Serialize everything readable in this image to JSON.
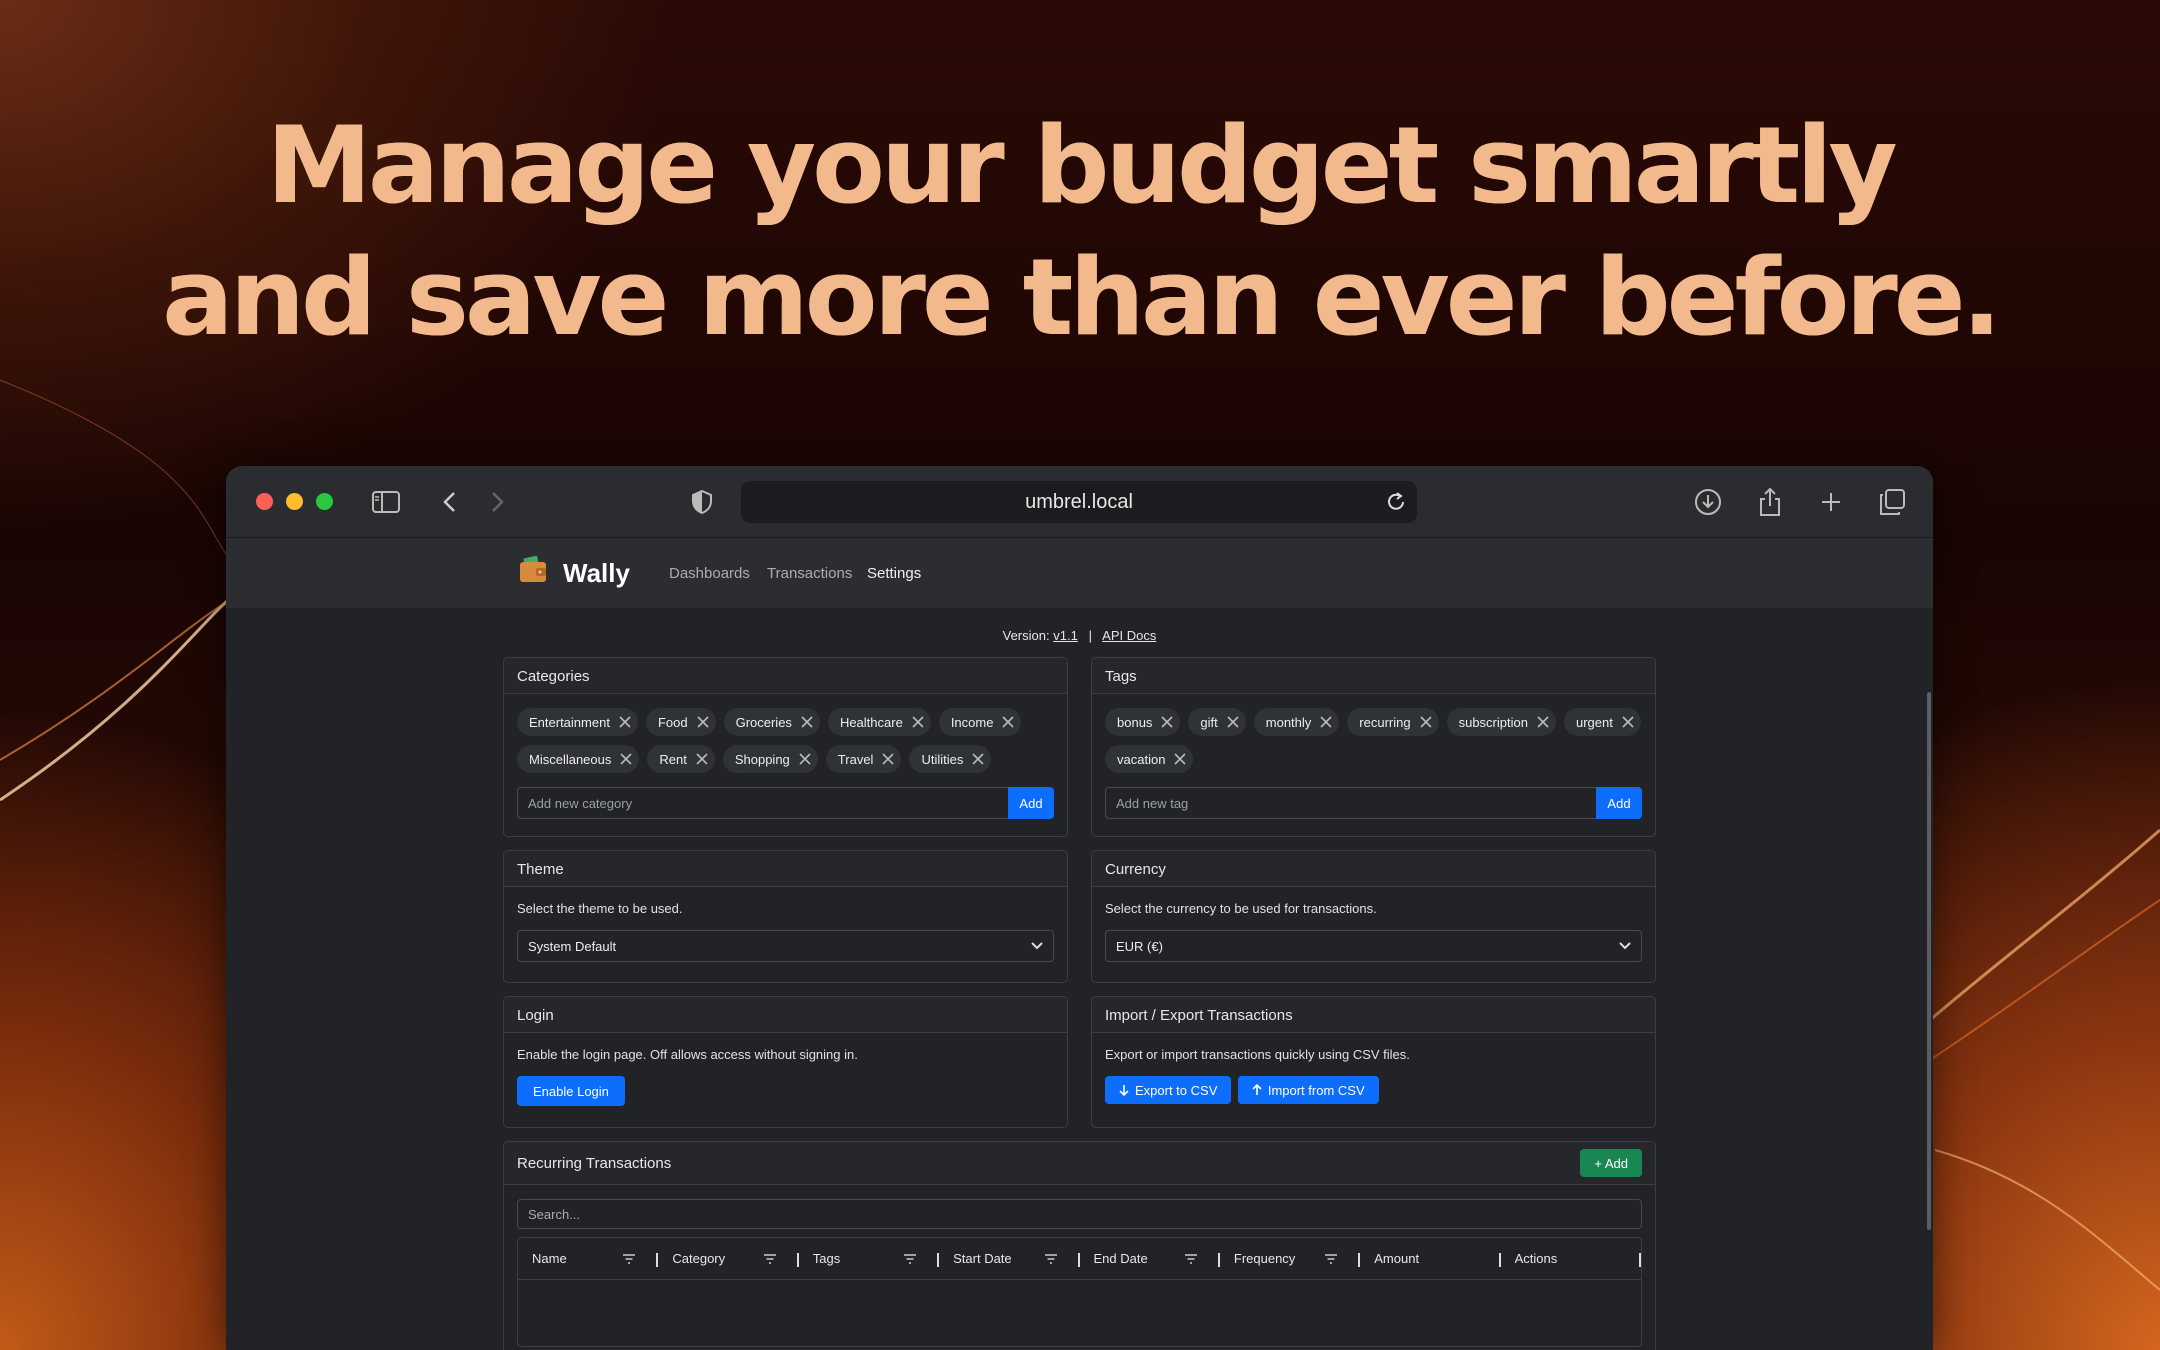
{
  "hero": {
    "line1": "Manage your budget smartly",
    "line2": "and save more than ever before."
  },
  "browser": {
    "url": "umbrel.local"
  },
  "app": {
    "name": "Wally",
    "nav": [
      "Dashboards",
      "Transactions",
      "Settings"
    ],
    "active_nav": "Settings"
  },
  "version": {
    "label": "Version:",
    "value": "v1.1",
    "separator": "|",
    "api_docs": "API Docs"
  },
  "categories": {
    "title": "Categories",
    "items": [
      "Entertainment",
      "Food",
      "Groceries",
      "Healthcare",
      "Income",
      "Miscellaneous",
      "Rent",
      "Shopping",
      "Travel",
      "Utilities"
    ],
    "placeholder": "Add new category",
    "add_label": "Add"
  },
  "tags": {
    "title": "Tags",
    "items": [
      "bonus",
      "gift",
      "monthly",
      "recurring",
      "subscription",
      "urgent",
      "vacation"
    ],
    "placeholder": "Add new tag",
    "add_label": "Add"
  },
  "theme": {
    "title": "Theme",
    "description": "Select the theme to be used.",
    "selected": "System Default"
  },
  "currency": {
    "title": "Currency",
    "description": "Select the currency to be used for transactions.",
    "selected": "EUR (€)"
  },
  "login": {
    "title": "Login",
    "description": "Enable the login page. Off allows access without signing in.",
    "button": "Enable Login"
  },
  "import_export": {
    "title": "Import / Export Transactions",
    "description": "Export or import transactions quickly using CSV files.",
    "export_label": "Export to CSV",
    "import_label": "Import from CSV"
  },
  "recurring": {
    "title": "Recurring Transactions",
    "add_label": "+ Add",
    "search_placeholder": "Search...",
    "columns": [
      "Name",
      "Category",
      "Tags",
      "Start Date",
      "End Date",
      "Frequency",
      "Amount",
      "Actions"
    ]
  },
  "colors": {
    "accent": "#0d6efd",
    "success": "#198754",
    "headline": "#f2b98c"
  }
}
